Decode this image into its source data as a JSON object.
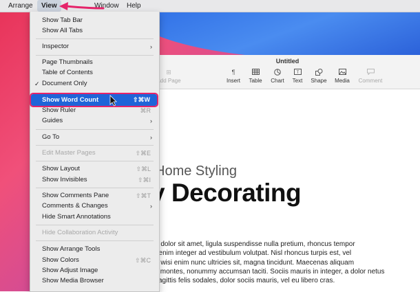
{
  "menubar": {
    "items": [
      "Arrange",
      "View",
      "Window",
      "Help"
    ]
  },
  "view_menu": {
    "show_tab_bar": "Show Tab Bar",
    "show_all_tabs": "Show All Tabs",
    "inspector": "Inspector",
    "page_thumbnails": "Page Thumbnails",
    "table_of_contents": "Table of Contents",
    "document_only": "Document Only",
    "checkmark": "✓",
    "show_word_count": "Show Word Count",
    "show_word_count_shortcut": "⇧⌘W",
    "show_ruler": "Show Ruler",
    "show_ruler_shortcut": "⌘R",
    "guides": "Guides",
    "go_to": "Go To",
    "edit_master_pages": "Edit Master Pages",
    "edit_master_pages_shortcut": "⇧⌘E",
    "show_layout": "Show Layout",
    "show_layout_shortcut": "⇧⌘L",
    "show_invisibles": "Show Invisibles",
    "show_invisibles_shortcut": "⇧⌘I",
    "show_comments_pane": "Show Comments Pane",
    "show_comments_pane_shortcut": "⇧⌘T",
    "comments_changes": "Comments & Changes",
    "hide_smart_annotations": "Hide Smart Annotations",
    "hide_collaboration_activity": "Hide Collaboration Activity",
    "show_arrange_tools": "Show Arrange Tools",
    "show_colors": "Show Colors",
    "show_colors_shortcut": "⇧⌘C",
    "show_adjust_image": "Show Adjust Image",
    "show_media_browser": "Show Media Browser",
    "submenu_arrow": "›"
  },
  "window": {
    "title": "Untitled",
    "toolbar": {
      "add_page": "Add Page",
      "insert": "Insert",
      "table": "Table",
      "chart": "Chart",
      "text": "Text",
      "shape": "Shape",
      "media": "Media",
      "comment": "Comment"
    }
  },
  "document": {
    "subtitle": "Home Styling",
    "heading": "y Decorating",
    "paragraph_lines": [
      "n dolor sit amet, ligula suspendisse nulla pretium, rhoncus tempor",
      ", enim integer ad vestibulum volutpat. Nisl rhoncus turpis est, vel",
      "e wisi enim nunc ultricies sit, magna tincidunt. Maecenas aliquam",
      "s montes, nonummy accumsan taciti. Sociis mauris in integer, a dolor netus",
      "sagittis felis sodales, dolor sociis mauris, vel eu libero cras."
    ]
  },
  "colors": {
    "highlight": "#1f64d8",
    "annotation": "#e5246a"
  }
}
